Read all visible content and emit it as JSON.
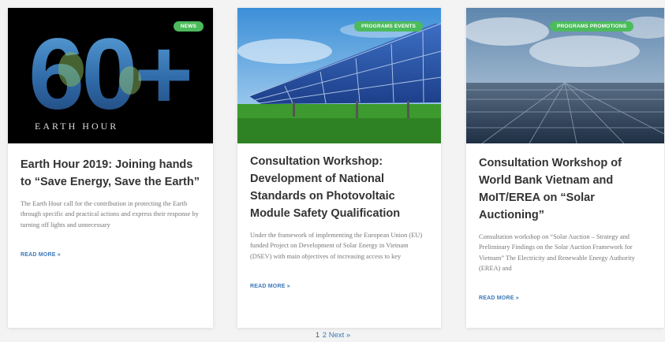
{
  "colors": {
    "badge": "#4cbb5c",
    "link": "#3b78b8",
    "title": "#333333",
    "excerpt": "#777777"
  },
  "posts": [
    {
      "badge": "NEWS",
      "title": "Earth Hour 2019: Joining hands to “Save Energy, Save the Earth”",
      "excerpt": "The Earth Hour call for the contribution in protecting the Earth through specific and practical actions and express their response by turning off lights and unnecessary",
      "read_more": "READ MORE »",
      "image": {
        "logo_text": "60+",
        "caption": "EARTH HOUR"
      }
    },
    {
      "badge": "PROGRAMS EVENTS",
      "title": "Consultation Workshop: Development of National Standards on Photovoltaic Module Safety Qualification",
      "excerpt": "Under the framework of implementing the European Union (EU) funded Project on Development of Solar Energy in Vietnam (DSEV) with main objectives of increasing access to key",
      "read_more": "READ MORE »"
    },
    {
      "badge": "PROGRAMS PROMOTIONS",
      "title": "Consultation Workshop of World Bank Vietnam and MoIT/EREA on “Solar Auctioning”",
      "excerpt": "Consultation workshop on “Solar Auction – Strategy and Preliminary Findings on the Solar Auction Framework for Vietnam” The Electricity and Renewable Energy Authority (EREA) and",
      "read_more": "READ MORE »"
    }
  ],
  "pagination": {
    "page1": "1",
    "page2": "2",
    "next": "Next »"
  }
}
